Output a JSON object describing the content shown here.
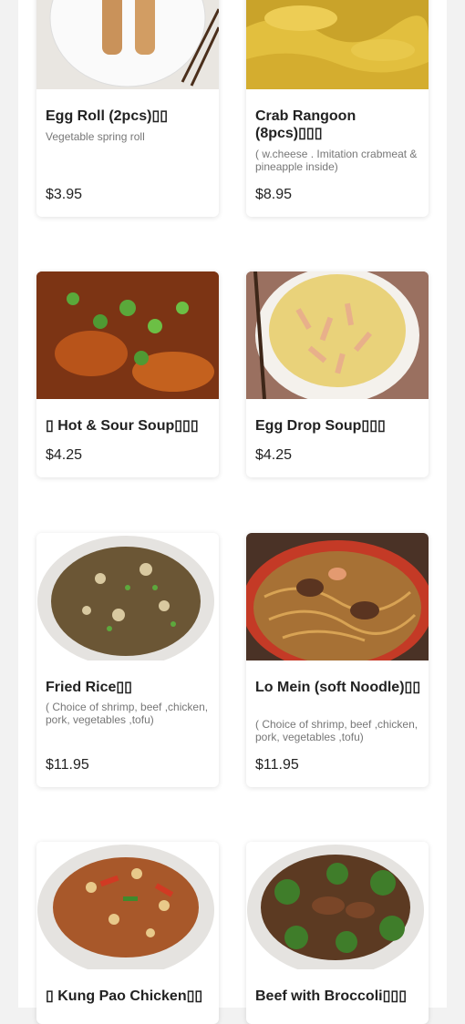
{
  "items": [
    {
      "name": "Egg Roll (2pcs)▯▯",
      "description": "Vegetable spring roll",
      "price": "$3.95",
      "image": "egg-roll-photo"
    },
    {
      "name": "Crab Rangoon (8pcs)▯▯▯",
      "description": "( w.cheese . Imitation crabmeat & pineapple inside)",
      "price": "$8.95",
      "image": "crab-rangoon-photo"
    },
    {
      "name": "▯ Hot & Sour Soup▯▯▯",
      "description": "",
      "price": "$4.25",
      "image": "hot-sour-soup-photo"
    },
    {
      "name": "Egg Drop Soup▯▯▯",
      "description": "",
      "price": "$4.25",
      "image": "egg-drop-soup-photo"
    },
    {
      "name": "Fried Rice▯▯",
      "description": "( Choice of shrimp, beef ,chicken, pork, vegetables ,tofu)",
      "price": "$11.95",
      "image": "fried-rice-photo"
    },
    {
      "name": "Lo Mein (soft Noodle)▯▯",
      "description": "( Choice of shrimp, beef ,chicken, pork, vegetables ,tofu)",
      "price": "$11.95",
      "image": "lo-mein-photo"
    },
    {
      "name": "▯ Kung Pao Chicken▯▯",
      "description": "",
      "price": "",
      "image": "kung-pao-chicken-photo"
    },
    {
      "name": "Beef with Broccoli▯▯▯",
      "description": "",
      "price": "",
      "image": "beef-broccoli-photo"
    }
  ]
}
